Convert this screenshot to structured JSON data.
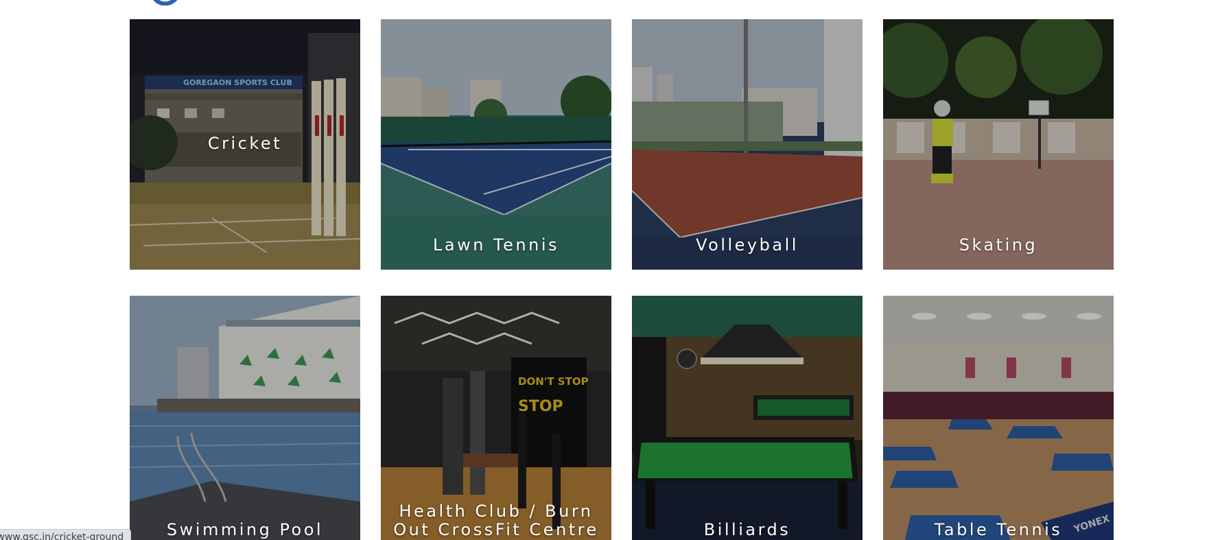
{
  "tiles": [
    {
      "label": "Cricket"
    },
    {
      "label": "Lawn Tennis"
    },
    {
      "label": "Volleyball"
    },
    {
      "label": "Skating"
    },
    {
      "label": "Swimming Pool"
    },
    {
      "label": "Health Club / Burn Out CrossFit Centre"
    },
    {
      "label": "Billiards"
    },
    {
      "label": "Table Tennis"
    }
  ],
  "scene_text": {
    "cricket_banner": "GOREGAON SPORTS CLUB",
    "gym_wall": "DON'T STOP WHEN IT HURTS STOP WHEN DONE",
    "tt_barrier": "YONEX"
  },
  "status_bar": {
    "url": "//www.gsc.in/cricket-ground"
  }
}
